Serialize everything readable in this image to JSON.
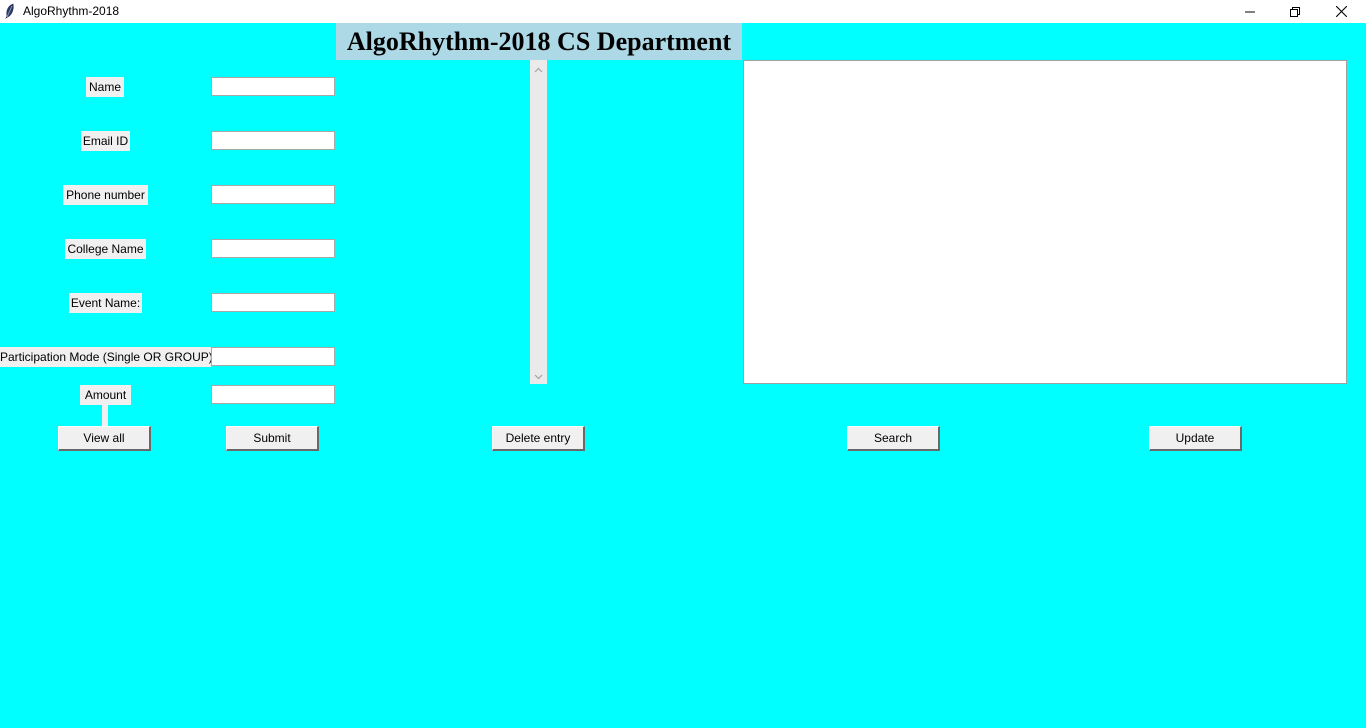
{
  "window": {
    "title": "AlgoRhythm-2018",
    "controls": [
      "minimize-icon",
      "restore-icon",
      "close-icon"
    ]
  },
  "header": {
    "title": "AlgoRhythm-2018 CS Department"
  },
  "form": {
    "fields": [
      {
        "label": "Name",
        "value": ""
      },
      {
        "label": "Email ID",
        "value": ""
      },
      {
        "label": "Phone number",
        "value": ""
      },
      {
        "label": "College Name",
        "value": ""
      },
      {
        "label": "Event Name:",
        "value": ""
      },
      {
        "label": "Participation Mode (Single OR GROUP)",
        "value": ""
      },
      {
        "label": "Amount",
        "value": ""
      }
    ]
  },
  "buttons": {
    "view_all": "View all",
    "submit": "Submit",
    "delete_entry": "Delete entry",
    "search": "Search",
    "update": "Update"
  },
  "listbox": {
    "items": []
  },
  "colors": {
    "background": "#00ffff",
    "header_bg": "#add8e6",
    "label_bg": "#f0f0f0"
  }
}
